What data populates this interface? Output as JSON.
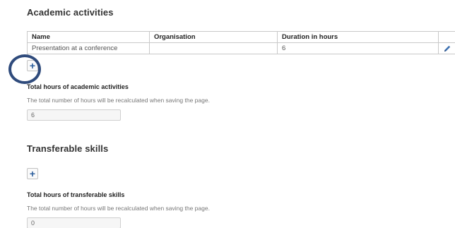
{
  "academic": {
    "title": "Academic activities",
    "table": {
      "headers": [
        "Name",
        "Organisation",
        "Duration in hours",
        ""
      ],
      "rows": [
        {
          "name": "Presentation at a conference",
          "organisation": "",
          "duration": "6"
        }
      ]
    },
    "add_label": "+",
    "total_label": "Total hours of academic activities",
    "help_text": "The total number of hours will be recalculated when saving the page.",
    "total_value": "6"
  },
  "transferable": {
    "title": "Transferable skills",
    "add_label": "+",
    "total_label": "Total hours of transferable skills",
    "help_text": "The total number of hours will be recalculated when saving the page.",
    "total_value": "0"
  },
  "icons": {
    "edit": "pencil-icon",
    "add": "plus-icon"
  },
  "colors": {
    "accent": "#2a5d9c",
    "highlight": "#2f4b7c",
    "border": "#c9c9c9"
  }
}
